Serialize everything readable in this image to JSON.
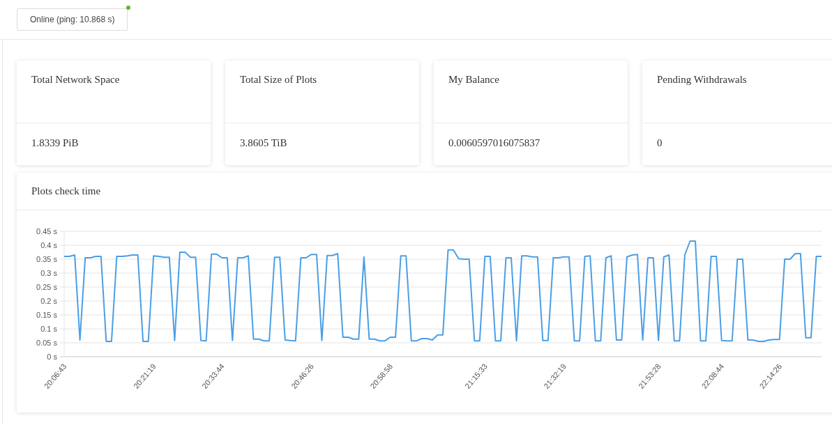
{
  "status": {
    "label": "Online (ping: 10.868 s)",
    "online": true
  },
  "stats": [
    {
      "title": "Total Network Space",
      "value": "1.8339 PiB"
    },
    {
      "title": "Total Size of Plots",
      "value": "3.8605 TiB"
    },
    {
      "title": "My Balance",
      "value": "0.0060597016075837"
    },
    {
      "title": "Pending Withdrawals",
      "value": "0"
    }
  ],
  "chart_panel": {
    "title": "Plots check time",
    "chart_data": {
      "type": "line",
      "grid": true,
      "ylim": [
        0,
        0.45
      ],
      "categories": [
        "20:06:43",
        null,
        null,
        null,
        null,
        null,
        null,
        null,
        null,
        null,
        null,
        null,
        null,
        null,
        null,
        null,
        null,
        "20:21:19",
        null,
        null,
        null,
        null,
        null,
        null,
        null,
        null,
        null,
        null,
        null,
        null,
        "20:33:44",
        null,
        null,
        null,
        null,
        null,
        null,
        null,
        null,
        null,
        null,
        null,
        null,
        null,
        null,
        null,
        null,
        "20:46:26",
        null,
        null,
        null,
        null,
        null,
        null,
        null,
        null,
        null,
        null,
        null,
        null,
        null,
        null,
        "20:58:58",
        null,
        null,
        null,
        null,
        null,
        null,
        null,
        null,
        null,
        null,
        null,
        null,
        null,
        null,
        null,
        null,
        null,
        "21:15:33",
        null,
        null,
        null,
        null,
        null,
        null,
        null,
        null,
        null,
        null,
        null,
        null,
        null,
        null,
        "21:32:19",
        null,
        null,
        null,
        null,
        null,
        null,
        null,
        null,
        null,
        null,
        null,
        null,
        null,
        null,
        null,
        null,
        null,
        "21:53:28",
        null,
        null,
        null,
        null,
        null,
        null,
        null,
        null,
        null,
        null,
        null,
        "22:08:44",
        null,
        null,
        null,
        null,
        null,
        null,
        null,
        null,
        null,
        null,
        "22:14:26",
        null,
        null,
        null,
        null,
        null,
        null,
        null,
        null
      ],
      "series": [
        {
          "color": "#4a9ee6",
          "values": [
            0.36,
            0.36,
            0.365,
            0.06,
            0.355,
            0.355,
            0.36,
            0.36,
            0.055,
            0.055,
            0.36,
            0.36,
            0.362,
            0.365,
            0.365,
            0.055,
            0.055,
            0.362,
            0.36,
            0.357,
            0.357,
            0.058,
            0.375,
            0.375,
            0.357,
            0.357,
            0.058,
            0.057,
            0.368,
            0.368,
            0.355,
            0.355,
            0.058,
            0.355,
            0.355,
            0.362,
            0.063,
            0.063,
            0.057,
            0.057,
            0.357,
            0.357,
            0.06,
            0.058,
            0.057,
            0.355,
            0.355,
            0.367,
            0.367,
            0.058,
            0.363,
            0.363,
            0.37,
            0.07,
            0.07,
            0.063,
            0.063,
            0.358,
            0.063,
            0.063,
            0.057,
            0.057,
            0.07,
            0.07,
            0.362,
            0.362,
            0.057,
            0.057,
            0.065,
            0.065,
            0.06,
            0.078,
            0.078,
            0.383,
            0.383,
            0.352,
            0.35,
            0.35,
            0.057,
            0.057,
            0.36,
            0.36,
            0.057,
            0.057,
            0.355,
            0.355,
            0.057,
            0.362,
            0.362,
            0.358,
            0.358,
            0.058,
            0.058,
            0.355,
            0.355,
            0.358,
            0.358,
            0.057,
            0.057,
            0.36,
            0.362,
            0.057,
            0.057,
            0.355,
            0.362,
            0.06,
            0.06,
            0.358,
            0.365,
            0.367,
            0.06,
            0.355,
            0.355,
            0.058,
            0.358,
            0.365,
            0.057,
            0.057,
            0.365,
            0.415,
            0.415,
            0.057,
            0.057,
            0.36,
            0.36,
            0.058,
            0.057,
            0.057,
            0.35,
            0.35,
            0.06,
            0.06,
            0.055,
            0.055,
            0.06,
            0.062,
            0.062,
            0.35,
            0.35,
            0.37,
            0.37,
            0.068,
            0.068,
            0.36,
            0.36
          ]
        }
      ],
      "yticks": [
        {
          "value": 0,
          "label": "0 s"
        },
        {
          "value": 0.05,
          "label": "0.05 s"
        },
        {
          "value": 0.1,
          "label": "0.1 s"
        },
        {
          "value": 0.15,
          "label": "0.15 s"
        },
        {
          "value": 0.2,
          "label": "0.2 s"
        },
        {
          "value": 0.25,
          "label": "0.25 s"
        },
        {
          "value": 0.3,
          "label": "0.3 s"
        },
        {
          "value": 0.35,
          "label": "0.35 s"
        },
        {
          "value": 0.4,
          "label": "0.4 s"
        },
        {
          "value": 0.45,
          "label": "0.45 s"
        }
      ]
    }
  }
}
